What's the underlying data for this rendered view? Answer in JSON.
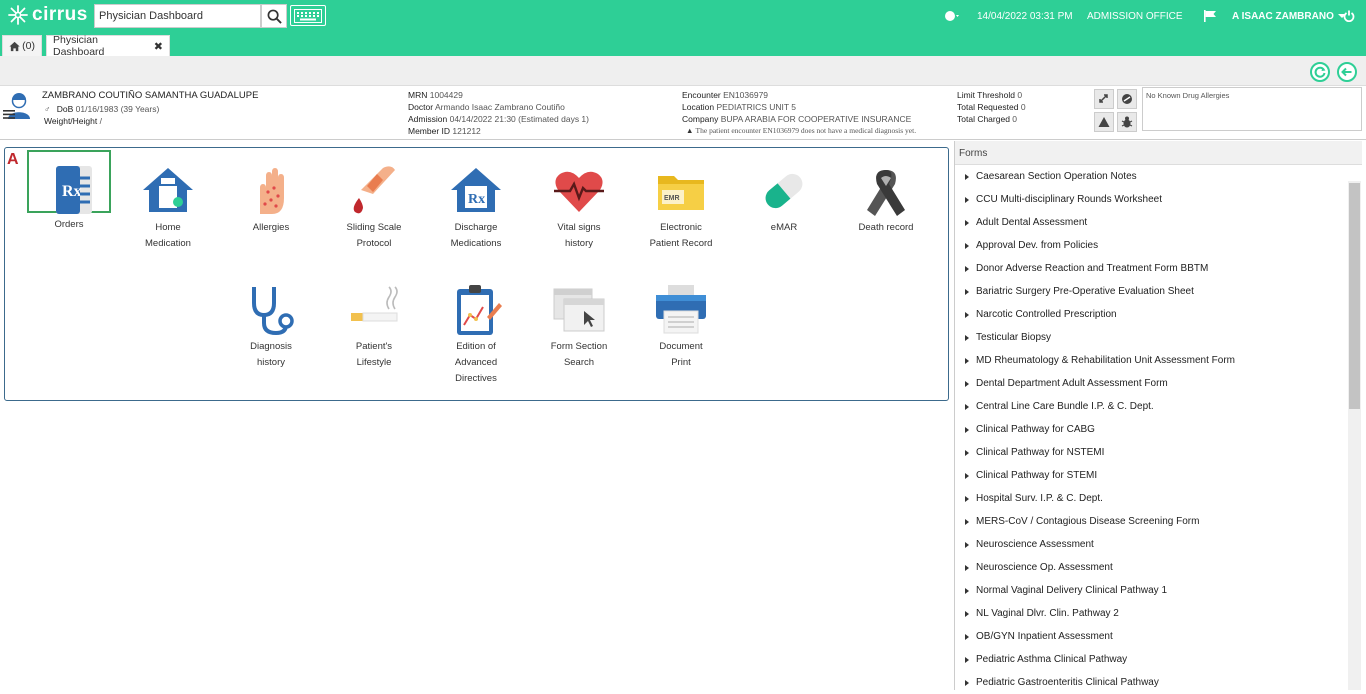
{
  "app": {
    "brand": "cirrus",
    "search_value": "Physician Dashboard",
    "datetime": "14/04/2022 03:31 PM",
    "office": "ADMISSION OFFICE",
    "user": "A ISAAC ZAMBRANO"
  },
  "tabs": {
    "home_label": "(0)",
    "active_label": "Physician Dashboard"
  },
  "patient": {
    "name": "ZAMBRANO COUTIÑO SAMANTHA GUADALUPE",
    "sex_symbol": "♂",
    "dob_label": "DoB",
    "dob_value": "01/16/1983 (39 Years)",
    "wh_label": "Weight/Height",
    "wh_value": "/",
    "mrn_label": "MRN",
    "mrn_value": "1004429",
    "doctor_label": "Doctor",
    "doctor_value": "Armando Isaac Zambrano Coutiño",
    "admission_label": "Admission",
    "admission_value": "04/14/2022 21:30 (Estimated days 1)",
    "member_label": "Member ID",
    "member_value": "121212",
    "encounter_label": "Encounter",
    "encounter_value": "EN1036979",
    "location_label": "Location",
    "location_value": "PEDIATRICS UNIT 5",
    "company_label": "Company",
    "company_value": "BUPA ARABIA FOR COOPERATIVE INSURANCE",
    "warning": "The patient encounter EN1036979 does not have a medical diagnosis yet.",
    "limit_label": "Limit Threshold",
    "limit_value": "0",
    "requested_label": "Total Requested",
    "requested_value": "0",
    "charged_label": "Total Charged",
    "charged_value": "0",
    "allergies": "No Known Drug Allergies"
  },
  "panel_letter": "A",
  "tiles": {
    "orders": "Orders",
    "home_med_1": "Home",
    "home_med_2": "Medication",
    "allergies": "Allergies",
    "sliding_1": "Sliding Scale",
    "sliding_2": "Protocol",
    "discharge_1": "Discharge",
    "discharge_2": "Medications",
    "vital_1": "Vital signs",
    "vital_2": "history",
    "epr_1": "Electronic",
    "epr_2": "Patient Record",
    "emar": "eMAR",
    "death": "Death record",
    "diag_1": "Diagnosis",
    "diag_2": "history",
    "life_1": "Patient's",
    "life_2": "Lifestyle",
    "adv_1": "Edition of",
    "adv_2": "Advanced",
    "adv_3": "Directives",
    "fss_1": "Form Section",
    "fss_2": "Search",
    "doc_1": "Document",
    "doc_2": "Print",
    "emr_badge": "EMR"
  },
  "forms": {
    "header": "Forms",
    "items": [
      "Caesarean Section Operation Notes",
      "CCU Multi-disciplinary Rounds Worksheet",
      "Adult Dental Assessment",
      "Approval Dev. from Policies",
      "Donor Adverse Reaction and Treatment Form BBTM",
      "Bariatric Surgery Pre-Operative Evaluation Sheet",
      "Narcotic Controlled Prescription",
      "Testicular Biopsy",
      "MD Rheumatology & Rehabilitation Unit Assessment Form",
      "Dental Department Adult Assessment Form",
      "Central Line Care Bundle I.P. & C. Dept.",
      "Clinical Pathway for CABG",
      "Clinical Pathway for NSTEMI",
      "Clinical Pathway for STEMI",
      "Hospital Surv. I.P. & C. Dept.",
      "MERS-CoV / Contagious Disease Screening Form",
      "Neuroscience Assessment",
      "Neuroscience Op. Assessment",
      "Normal Vaginal Delivery Clinical Pathway 1",
      "NL Vaginal Dlvr. Clin. Pathway 2",
      "OB/GYN Inpatient Assessment",
      "Pediatric Asthma Clinical Pathway",
      "Pediatric Gastroenteritis Clinical Pathway"
    ]
  },
  "colors": {
    "brand_green": "#2ecf96",
    "selected_border": "#3aa35b",
    "panel_border": "#3c6a8c",
    "icon_blue": "#2f6db3"
  }
}
